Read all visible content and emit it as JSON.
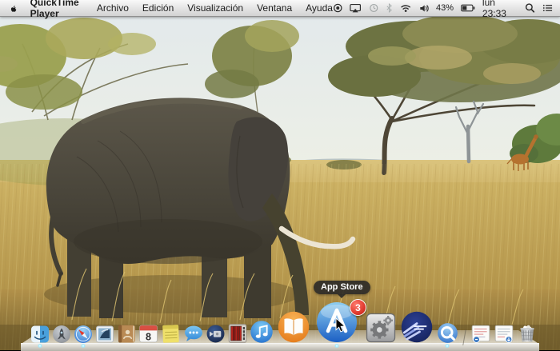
{
  "menu_bar": {
    "apple_icon": "apple-logo",
    "app_name": "QuickTime Player",
    "menus": [
      "Archivo",
      "Edición",
      "Visualización",
      "Ventana",
      "Ayuda"
    ],
    "status": {
      "battery_percent": "43%",
      "clock": "lun 23:33",
      "icons": [
        "record-icon",
        "airplay-display-icon",
        "time-machine-icon",
        "bluetooth-icon",
        "wifi-icon",
        "volume-icon",
        "battery-icon",
        "spotlight-icon",
        "notification-center-icon"
      ]
    }
  },
  "desktop": {
    "wallpaper": "african-savanna-elephant-acacia-trees-giraffe"
  },
  "dock": {
    "tooltip": "App Store",
    "app_store_badge": "3",
    "calendar_day": "8",
    "running_indicators": [
      "finder",
      "safari",
      "app-store",
      "quicktime-player"
    ],
    "icons": [
      "finder",
      "launchpad",
      "safari",
      "mail",
      "contacts",
      "calendar",
      "notes",
      "messages",
      "facetime",
      "photo-booth",
      "itunes",
      "ibooks",
      "app-store",
      "system-preferences",
      "eclipse",
      "quicktime-player",
      "documents-stack",
      "downloads-stack",
      "trash"
    ]
  },
  "colors": {
    "badge_red": "#e03a2f",
    "tooltip_bg": "rgba(38,38,38,0.88)",
    "indicator_cyan": "#9be9ff",
    "menu_text": "#1c1c1c",
    "grass_gold": "#c4a55b",
    "sky": "#e5ebec"
  }
}
